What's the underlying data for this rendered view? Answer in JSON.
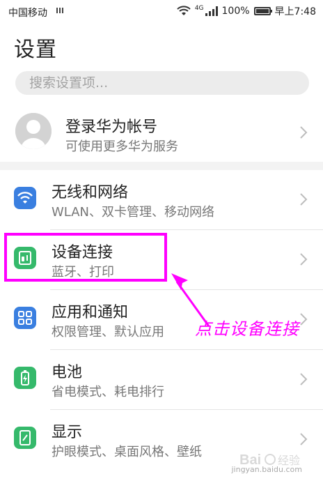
{
  "status_bar": {
    "carrier": "中国移动",
    "network": "4G",
    "battery_text": "100%",
    "battery_level": 1.0,
    "time": "早上7:48"
  },
  "page": {
    "title": "设置"
  },
  "search": {
    "placeholder": "搜索设置项..."
  },
  "account": {
    "title": "登录华为帐号",
    "subtitle": "可使用更多华为服务"
  },
  "settings": [
    {
      "title": "无线和网络",
      "subtitle": "WLAN、双卡管理、移动网络",
      "icon": "wifi-icon",
      "color": "#3a7fe0"
    },
    {
      "title": "设备连接",
      "subtitle": "蓝牙、打印",
      "icon": "device-connection-icon",
      "color": "#35b96b"
    },
    {
      "title": "应用和通知",
      "subtitle": "权限管理、默认应用",
      "icon": "apps-grid-icon",
      "color": "#3a7fe0"
    },
    {
      "title": "电池",
      "subtitle": "省电模式、耗电排行",
      "icon": "battery-icon",
      "color": "#35b96b"
    },
    {
      "title": "显示",
      "subtitle": "护眼模式、桌面风格、壁纸",
      "icon": "display-icon",
      "color": "#35b96b"
    }
  ],
  "annotation": {
    "text": "点击设备连接",
    "color": "#ff00ff"
  },
  "watermark": {
    "text": "jingyan.baidu.com"
  }
}
